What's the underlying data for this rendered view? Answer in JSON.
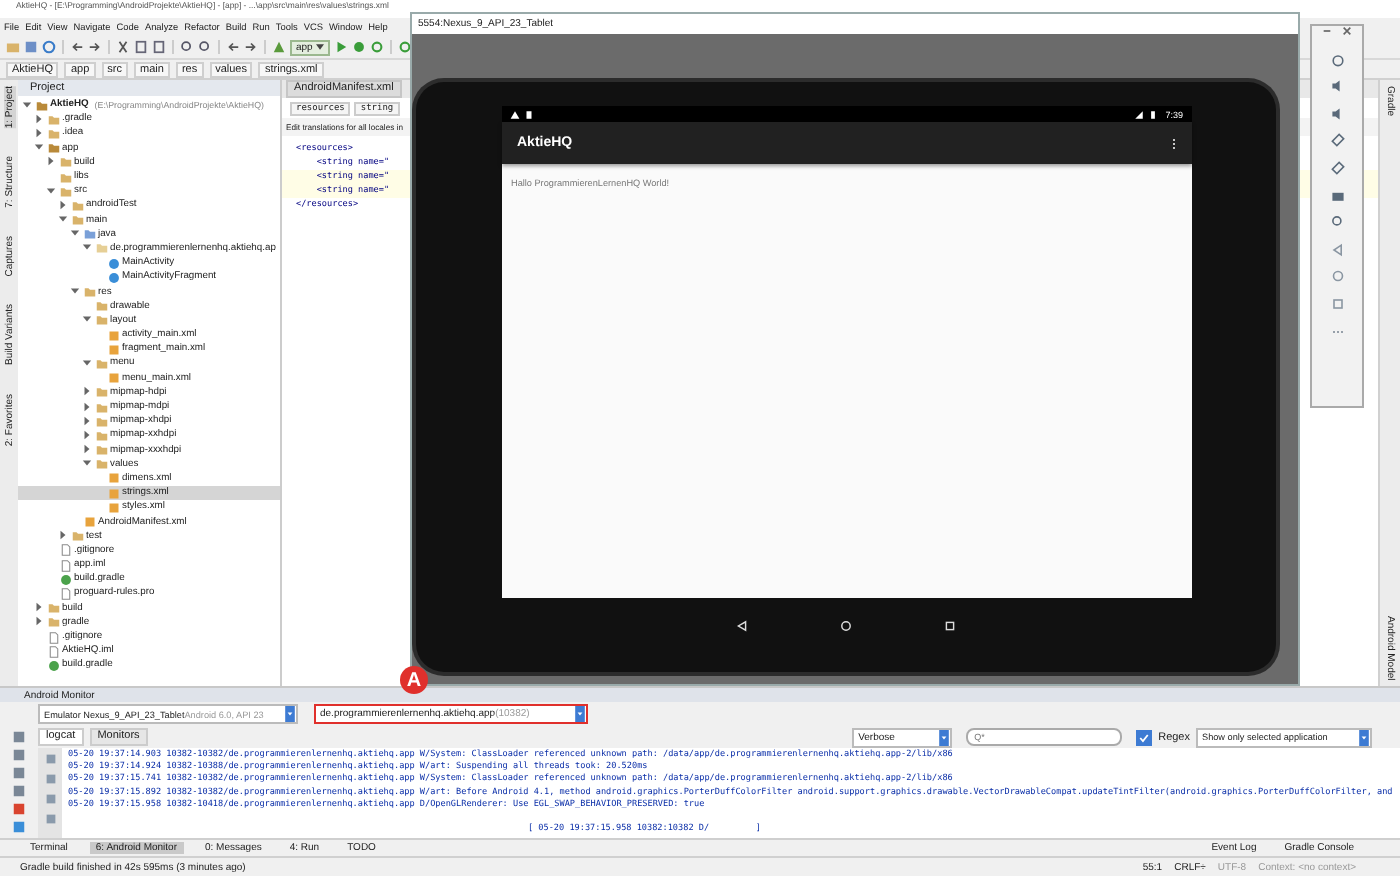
{
  "window": {
    "title": "AktieHQ - [E:\\Programming\\AndroidProjekte\\AktieHQ] - [app] - ...\\app\\src\\main\\res\\values\\strings.xml"
  },
  "menu": [
    "File",
    "Edit",
    "View",
    "Navigate",
    "Code",
    "Analyze",
    "Refactor",
    "Build",
    "Run",
    "Tools",
    "VCS",
    "Window",
    "Help"
  ],
  "toolbar": {
    "run_config": "app"
  },
  "breadcrumbs": [
    "AktieHQ",
    "app",
    "src",
    "main",
    "res",
    "values",
    "strings.xml"
  ],
  "left_strip": [
    {
      "label": "1: Project",
      "selected": true
    },
    {
      "label": "7: Structure",
      "selected": false
    },
    {
      "label": "Captures",
      "selected": false
    },
    {
      "label": "Build Variants",
      "selected": false
    },
    {
      "label": "2: Favorites",
      "selected": false
    }
  ],
  "right_strip": [
    "Gradle",
    "Android Model"
  ],
  "project": {
    "title": "Project",
    "tree": [
      {
        "label": "AktieHQ",
        "path": "(E:\\Programming\\AndroidProjekte\\AktieHQ)",
        "kind": "module",
        "expanded": true,
        "selected": false,
        "children": [
          {
            "label": ".gradle",
            "kind": "folder",
            "expanded": false,
            "selected": false
          },
          {
            "label": ".idea",
            "kind": "folder",
            "expanded": false,
            "selected": false
          },
          {
            "label": "app",
            "kind": "module",
            "expanded": true,
            "selected": false,
            "children": [
              {
                "label": "build",
                "kind": "folder",
                "expanded": false,
                "selected": false
              },
              {
                "label": "libs",
                "kind": "folder",
                "selected": false
              },
              {
                "label": "src",
                "kind": "folder",
                "expanded": true,
                "selected": false,
                "children": [
                  {
                    "label": "androidTest",
                    "kind": "folder",
                    "expanded": false,
                    "selected": false
                  },
                  {
                    "label": "main",
                    "kind": "folder",
                    "expanded": true,
                    "selected": false,
                    "children": [
                      {
                        "label": "java",
                        "kind": "source",
                        "expanded": true,
                        "selected": false,
                        "children": [
                          {
                            "label": "de.programmierenlernenhq.aktiehq.ap",
                            "kind": "package",
                            "expanded": true,
                            "selected": false,
                            "children": [
                              {
                                "label": "MainActivity",
                                "kind": "class",
                                "selected": false
                              },
                              {
                                "label": "MainActivityFragment",
                                "kind": "class",
                                "selected": false
                              }
                            ]
                          }
                        ]
                      },
                      {
                        "label": "res",
                        "kind": "folder",
                        "expanded": true,
                        "selected": false,
                        "children": [
                          {
                            "label": "drawable",
                            "kind": "folder",
                            "selected": false
                          },
                          {
                            "label": "layout",
                            "kind": "folder",
                            "expanded": true,
                            "selected": false,
                            "children": [
                              {
                                "label": "activity_main.xml",
                                "kind": "xml",
                                "selected": false
                              },
                              {
                                "label": "fragment_main.xml",
                                "kind": "xml",
                                "selected": false
                              }
                            ]
                          },
                          {
                            "label": "menu",
                            "kind": "folder",
                            "expanded": true,
                            "selected": false,
                            "children": [
                              {
                                "label": "menu_main.xml",
                                "kind": "xml",
                                "selected": false
                              }
                            ]
                          },
                          {
                            "label": "mipmap-hdpi",
                            "kind": "folder",
                            "expanded": false,
                            "selected": false
                          },
                          {
                            "label": "mipmap-mdpi",
                            "kind": "folder",
                            "expanded": false,
                            "selected": false
                          },
                          {
                            "label": "mipmap-xhdpi",
                            "kind": "folder",
                            "expanded": false,
                            "selected": false
                          },
                          {
                            "label": "mipmap-xxhdpi",
                            "kind": "folder",
                            "expanded": false,
                            "selected": false
                          },
                          {
                            "label": "mipmap-xxxhdpi",
                            "kind": "folder",
                            "expanded": false,
                            "selected": false
                          },
                          {
                            "label": "values",
                            "kind": "folder",
                            "expanded": true,
                            "selected": false,
                            "children": [
                              {
                                "label": "dimens.xml",
                                "kind": "xml",
                                "selected": false
                              },
                              {
                                "label": "strings.xml",
                                "kind": "xml",
                                "selected": true
                              },
                              {
                                "label": "styles.xml",
                                "kind": "xml",
                                "selected": false
                              }
                            ]
                          }
                        ]
                      },
                      {
                        "label": "AndroidManifest.xml",
                        "kind": "xml",
                        "selected": false
                      }
                    ]
                  },
                  {
                    "label": "test",
                    "kind": "folder",
                    "expanded": false,
                    "selected": false
                  }
                ]
              },
              {
                "label": ".gitignore",
                "kind": "file",
                "selected": false
              },
              {
                "label": "app.iml",
                "kind": "file",
                "selected": false
              },
              {
                "label": "build.gradle",
                "kind": "gradle",
                "selected": false
              },
              {
                "label": "proguard-rules.pro",
                "kind": "file",
                "selected": false
              }
            ]
          },
          {
            "label": "build",
            "kind": "folder",
            "expanded": false,
            "selected": false
          },
          {
            "label": "gradle",
            "kind": "folder",
            "expanded": false,
            "selected": false
          },
          {
            "label": ".gitignore",
            "kind": "file",
            "selected": false
          },
          {
            "label": "AktieHQ.iml",
            "kind": "file",
            "selected": false
          },
          {
            "label": "build.gradle",
            "kind": "gradle",
            "selected": false
          }
        ]
      }
    ]
  },
  "editor": {
    "tabs": [
      {
        "label": "AndroidManifest.xml",
        "selected": false
      }
    ],
    "crumbs": [
      "resources",
      "string"
    ],
    "banner": "Edit translations for all locales in",
    "lines": [
      {
        "text": "<resources>",
        "highlighted": false
      },
      {
        "text": "    <string name=\"",
        "highlighted": false
      },
      {
        "text": "    <string name=\"",
        "highlighted": true
      },
      {
        "text": "    <string name=\"",
        "highlighted": true
      },
      {
        "text": "</resources>",
        "highlighted": false
      }
    ]
  },
  "emulator": {
    "title": "5554:Nexus_9_API_23_Tablet",
    "clock": "7:39",
    "app_title": "AktieHQ",
    "message": "Hallo ProgrammierenLernenHQ World!"
  },
  "monitor": {
    "title": "Android Monitor",
    "device": "Emulator Nexus_9_API_23_Tablet",
    "device_detail": "Android 6.0, API 23",
    "process": "de.programmierenlernenhq.aktiehq.app",
    "process_id": "(10382)",
    "annotation": "A",
    "tabs": [
      {
        "label": "logcat",
        "selected": true
      },
      {
        "label": "Monitors",
        "selected": false
      }
    ],
    "level": "Verbose",
    "search": {
      "placeholder": "Q*"
    },
    "regex": {
      "label": "Regex",
      "checked": true
    },
    "filter": "Show only selected application",
    "log": [
      "05-20 19:37:14.903 10382-10382/de.programmierenlernenhq.aktiehq.app W/System: ClassLoader referenced unknown path: /data/app/de.programmierenlernenhq.aktiehq.app-2/lib/x86",
      "05-20 19:37:14.924 10382-10388/de.programmierenlernenhq.aktiehq.app W/art: Suspending all threads took: 20.520ms",
      "05-20 19:37:15.741 10382-10382/de.programmierenlernenhq.aktiehq.app W/System: ClassLoader referenced unknown path: /data/app/de.programmierenlernenhq.aktiehq.app-2/lib/x86",
      "05-20 19:37:15.892 10382-10382/de.programmierenlernenhq.aktiehq.app W/art: Before Android 4.1, method android.graphics.PorterDuffColorFilter android.support.graphics.drawable.VectorDrawableCompat.updateTintFilter(android.graphics.PorterDuffColorFilter, and",
      "05-20 19:37:15.958 10382-10418/de.programmierenlernenhq.aktiehq.app D/OpenGLRenderer: Use EGL_SWAP_BEHAVIOR_PRESERVED: true"
    ],
    "log_footer": "[ 05-20 19:37:15.958 10382:10382 D/         ]"
  },
  "bottom_tabs": [
    {
      "label": "Terminal",
      "selected": false
    },
    {
      "label": "6: Android Monitor",
      "selected": true
    },
    {
      "label": "0: Messages",
      "selected": false
    },
    {
      "label": "4: Run",
      "selected": false
    },
    {
      "label": "TODO",
      "selected": false
    }
  ],
  "bottom_tabs_right": [
    "Event Log",
    "Gradle Console"
  ],
  "status_bar": {
    "message": "Gradle build finished in 42s 595ms (3 minutes ago)",
    "position": "55:1",
    "line_sep": "CRLF÷",
    "encoding": "UTF-8",
    "context": "Context: <no context>"
  }
}
